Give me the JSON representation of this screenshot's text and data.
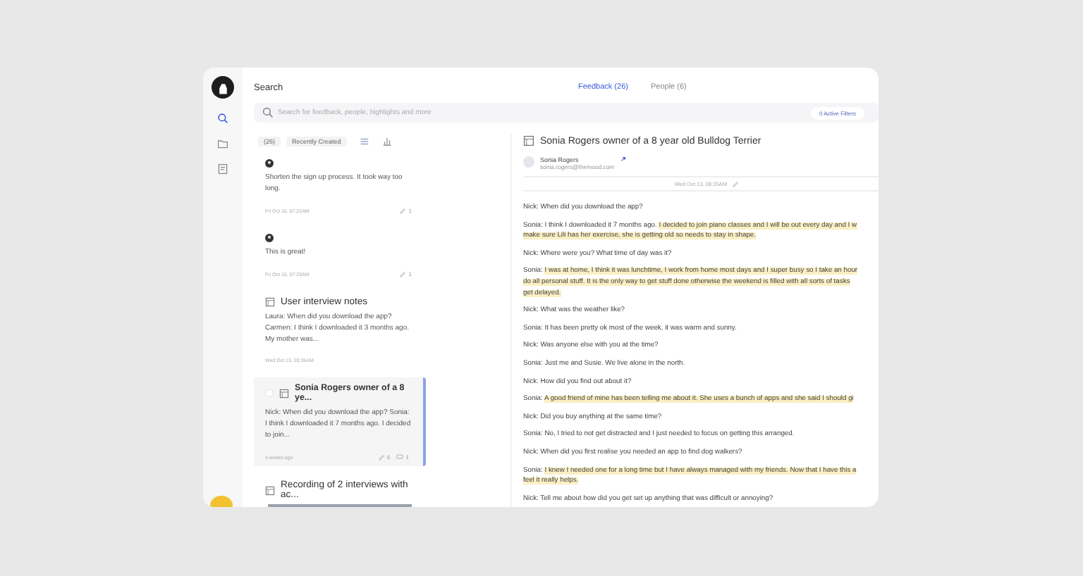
{
  "header": {
    "title": "Search"
  },
  "tabs": [
    {
      "label": "Feedback (26)",
      "selected": true
    },
    {
      "label": "People (6)",
      "selected": false
    }
  ],
  "search": {
    "placeholder": "Search for feedback, people, highlights and more",
    "filters_button": "0 Active Filters"
  },
  "sidebar": {
    "items": [
      {
        "kind": "search",
        "selected": true
      },
      {
        "kind": "folder",
        "selected": false
      },
      {
        "kind": "notes",
        "selected": false
      }
    ]
  },
  "list_toolbar": {
    "count": "(26)",
    "sort": "Recently Created"
  },
  "feedback_items": [
    {
      "kind": "note",
      "selected": false,
      "text": "Shorten the sign up process. It took way too long.",
      "date": "Fri Oct 15, 07:22AM",
      "highlights": "1"
    },
    {
      "kind": "note",
      "selected": false,
      "text": "This is great!",
      "date": "Fri Oct 15, 07:20AM",
      "highlights": "1"
    },
    {
      "kind": "document",
      "selected": false,
      "title": "User interview notes",
      "text": "Laura: When did you download the app? Carmen: I think I downloaded it 3 months ago. My mother was...",
      "date": "Wed Oct 13, 03:35AM"
    },
    {
      "kind": "document",
      "selected": true,
      "title": "Sonia Rogers owner of a 8 ye...",
      "text": "Nick: When did you download the app? Sonia: I think I downloaded it 7 months ago. I decided to join...",
      "date": "4 weeks ago",
      "highlights": "6",
      "comments": "1"
    },
    {
      "kind": "recording",
      "selected": false,
      "title": "Recording of 2 interviews with ac..."
    }
  ],
  "detail": {
    "title": "Sonia Rogers owner of a 8 year old Bulldog Terrier",
    "person_name": "Sonia Rogers",
    "person_email": "sonia.rogers@themood.com",
    "date": "Wed Oct 13, 08:25AM",
    "transcript": [
      [
        [
          {
            "text": "Nick: When did you download the app?",
            "highlighted": false
          }
        ]
      ],
      [
        [
          {
            "text": "Sonia: I think I downloaded it 7 months ago. ",
            "highlighted": false
          },
          {
            "text": "I decided to join piano classes and I will be out every day and I w",
            "highlighted": true
          }
        ],
        [
          {
            "text": "make sure Lili has her exercise, she is getting old so needs to stay in shape.",
            "highlighted": true
          }
        ]
      ],
      [
        [
          {
            "text": "Nick: Where were you? What time of day was it?",
            "highlighted": false
          }
        ]
      ],
      [
        [
          {
            "text": "Sonia: ",
            "highlighted": false
          },
          {
            "text": "I was at home, I think it was lunchtime, I work from home most days and I super busy so I take an hour",
            "highlighted": true
          }
        ],
        [
          {
            "text": "do all personal stuff. It is the only way to get stuff done otherwise the weekend is filled with all sorts of tasks",
            "highlighted": true
          }
        ],
        [
          {
            "text": "get delayed.",
            "highlighted": true
          }
        ]
      ],
      [
        [
          {
            "text": "Nick: What was the weather like?",
            "highlighted": false
          }
        ]
      ],
      [
        [
          {
            "text": "Sonia: It has been pretty ok most of the week, it was warm and sunny.",
            "highlighted": false
          }
        ]
      ],
      [
        [
          {
            "text": "Nick: Was anyone else with you at the time?",
            "highlighted": false
          }
        ]
      ],
      [
        [
          {
            "text": "Sonia: Just me and Susie. We live alone in the north.",
            "highlighted": false
          }
        ]
      ],
      [
        [
          {
            "text": "Nick: How did you find out about it?",
            "highlighted": false
          }
        ]
      ],
      [
        [
          {
            "text": "Sonia: ",
            "highlighted": false
          },
          {
            "text": "A good friend of mine has been telling me about it. She uses a bunch of apps and she said I should gi",
            "highlighted": true
          }
        ]
      ],
      [
        [
          {
            "text": "Nick: Did you buy anything at the same time?",
            "highlighted": false
          }
        ]
      ],
      [
        [
          {
            "text": "Sonia: No, I tried to not get distracted and I just needed to focus on getting this arranged.",
            "highlighted": false
          }
        ]
      ],
      [
        [
          {
            "text": "Nick: When did you first realise you needed an app to find dog walkers?",
            "highlighted": false
          }
        ]
      ],
      [
        [
          {
            "text": "Sonia: ",
            "highlighted": false
          },
          {
            "text": "I knew I needed one for a long time but I have always managed with my friends. Now that I have this a",
            "highlighted": true
          }
        ],
        [
          {
            "text": "feel it really helps.",
            "highlighted": true
          }
        ]
      ],
      [
        [
          {
            "text": "Nick: Tell me about how did you get set up anything that was difficult or annoying?",
            "highlighted": false
          }
        ]
      ]
    ]
  }
}
